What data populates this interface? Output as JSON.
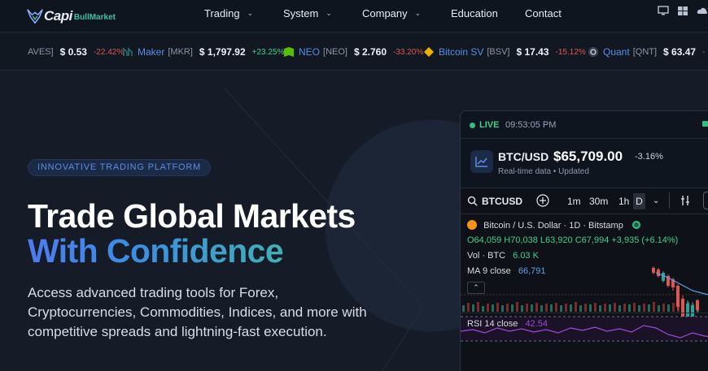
{
  "brand": {
    "name": "Capi",
    "suffix": "BullMarket"
  },
  "nav": {
    "items": [
      {
        "label": "Trading",
        "has_dropdown": true
      },
      {
        "label": "System",
        "has_dropdown": true
      },
      {
        "label": "Company",
        "has_dropdown": true
      },
      {
        "label": "Education",
        "has_dropdown": false
      },
      {
        "label": "Contact",
        "has_dropdown": false
      }
    ],
    "icons": [
      "monitor-icon",
      "windows-icon",
      "cloud-icon"
    ]
  },
  "ticker": [
    {
      "name": "",
      "symbol": "AVES]",
      "price": "$ 0.53",
      "change": "-22.42%",
      "direction": "down"
    },
    {
      "name": "Maker",
      "symbol": "[MKR]",
      "price": "$ 1,797.92",
      "change": "+23.25%",
      "direction": "up"
    },
    {
      "name": "NEO",
      "symbol": "[NEO]",
      "price": "$ 2.760",
      "change": "-33.20%",
      "direction": "down"
    },
    {
      "name": "Bitcoin SV",
      "symbol": "[BSV]",
      "price": "$ 17.43",
      "change": "-15.12%",
      "direction": "down"
    },
    {
      "name": "Quant",
      "symbol": "[QNT]",
      "price": "$ 63.47",
      "change": "-",
      "direction": "down"
    }
  ],
  "hero": {
    "badge": "INNOVATIVE TRADING PLATFORM",
    "title_line1": "Trade Global Markets",
    "title_line2": "With Confidence",
    "lead": "Access advanced trading tools for Forex, Cryptocurrencies, Commodities, Indices, and more with competitive spreads and lightning-fast execution."
  },
  "card": {
    "live_label": "LIVE",
    "time": "09:53:05 PM",
    "pair": "BTC/USD",
    "price": "$65,709.00",
    "change": "-3.16%",
    "subtitle": "Real-time data • Updated",
    "chart": {
      "symbol": "BTCUSD",
      "intervals": [
        "1m",
        "30m",
        "1h",
        "D"
      ],
      "active_interval": "D",
      "title": "Bitcoin / U.S. Dollar · 1D · Bitstamp",
      "ohlc": "O64,059 H70,038 L63,920 C67,994 +3,935 (+6.14%)",
      "vol_label": "Vol · BTC",
      "vol_value": "6.03 K",
      "ma_label": "MA 9 close",
      "ma_value": "66,791",
      "rsi_label": "RSI 14 close",
      "rsi_value": "42.54"
    }
  },
  "colors": {
    "accent": "#4e7bf0",
    "positive": "#3fcf8e",
    "negative": "#e0564f"
  }
}
